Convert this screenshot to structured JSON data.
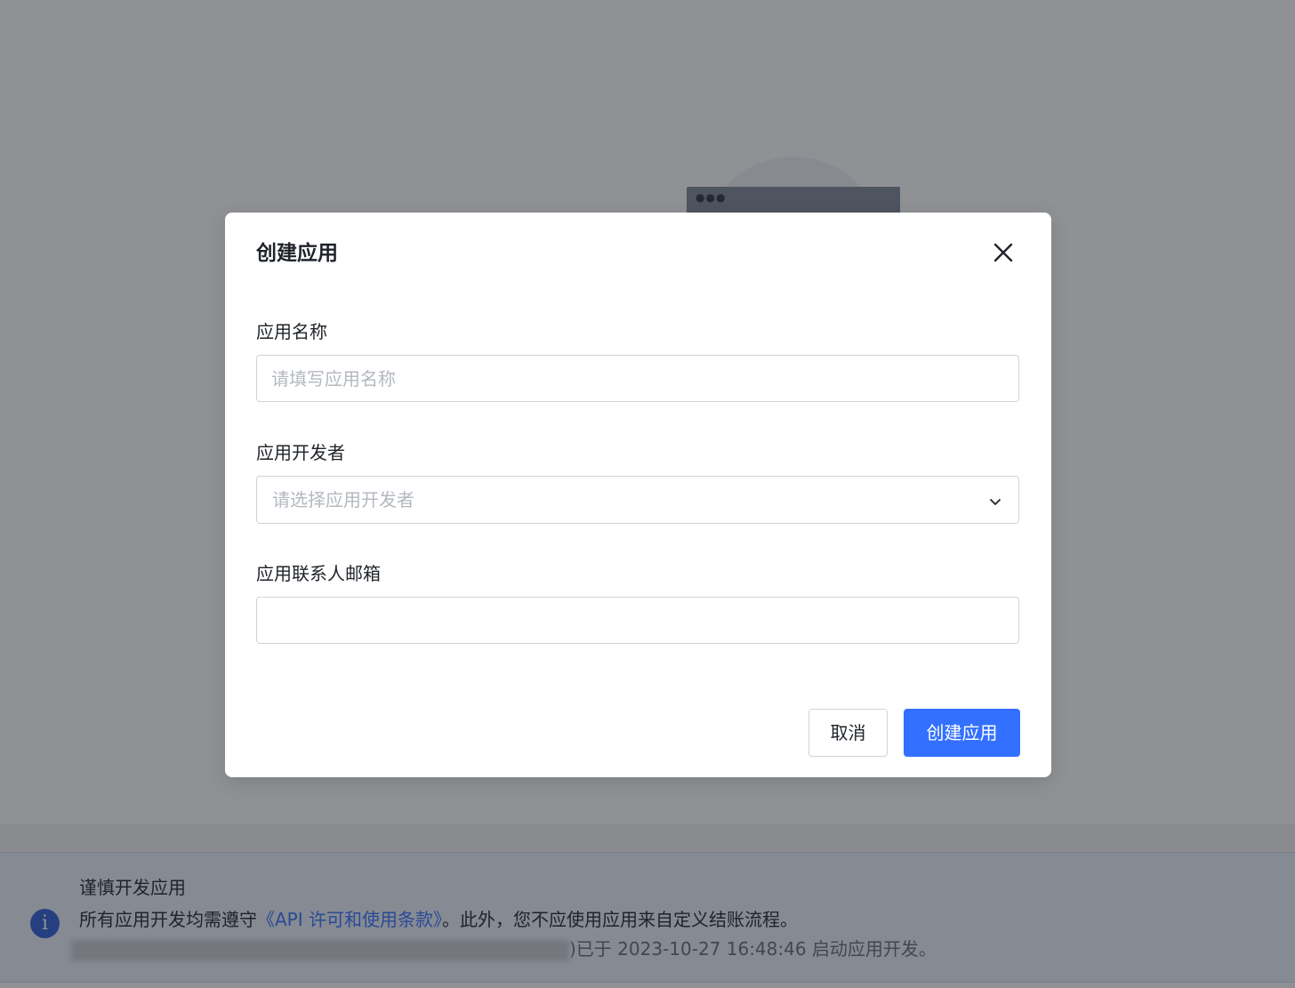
{
  "modal": {
    "title": "创建应用",
    "fields": {
      "app_name": {
        "label": "应用名称",
        "placeholder": "请填写应用名称",
        "value": ""
      },
      "developer": {
        "label": "应用开发者",
        "placeholder": "请选择应用开发者"
      },
      "contact_email": {
        "label": "应用联系人邮箱",
        "value": ""
      }
    },
    "buttons": {
      "cancel": "取消",
      "submit": "创建应用"
    }
  },
  "notice": {
    "title": "谨慎开发应用",
    "body_prefix": "所有应用开发均需遵守",
    "link_text": "《API 许可和使用条款》",
    "body_suffix": "。此外，您不应使用应用来自定义结账流程。",
    "meta_text": ")已于 2023-10-27 16:48:46 启动应用开发。"
  },
  "colors": {
    "primary": "#3370ff",
    "overlay": "rgba(31,35,41,0.5)",
    "notice_icon": "#2d5bd6"
  }
}
